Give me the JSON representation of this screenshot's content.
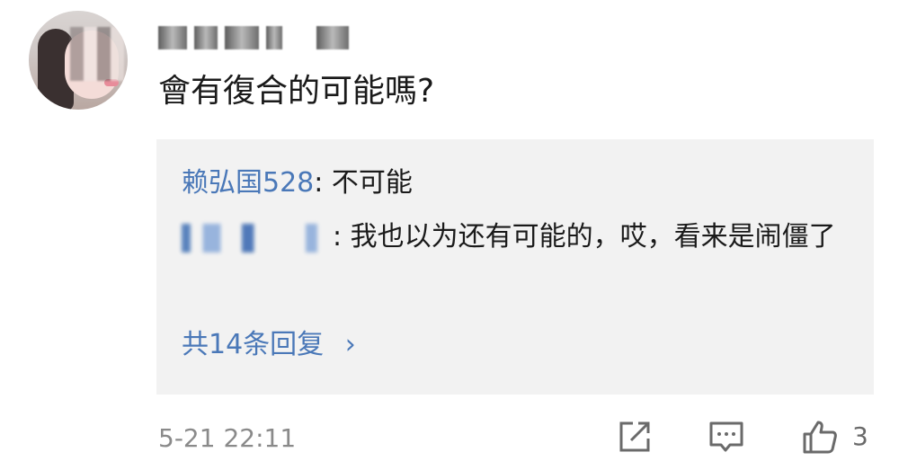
{
  "comment": {
    "text": "會有復合的可能嗎?",
    "timestamp": "5-21 22:11",
    "like_count": "3"
  },
  "replies": [
    {
      "name": "赖弘国528",
      "separator": ": ",
      "text": "不可能"
    },
    {
      "separator": ": ",
      "text": "我也以为还有可能的，哎，看来是闹僵了"
    }
  ],
  "more_replies_label": "共14条回复",
  "more_replies_chevron": "›",
  "icons": {
    "share": "share-icon",
    "reply": "comment-icon",
    "like": "thumbs-up-icon"
  },
  "colors": {
    "link": "#4a78b8",
    "reply_bg": "#f2f2f2",
    "meta": "#8a8a8a"
  }
}
